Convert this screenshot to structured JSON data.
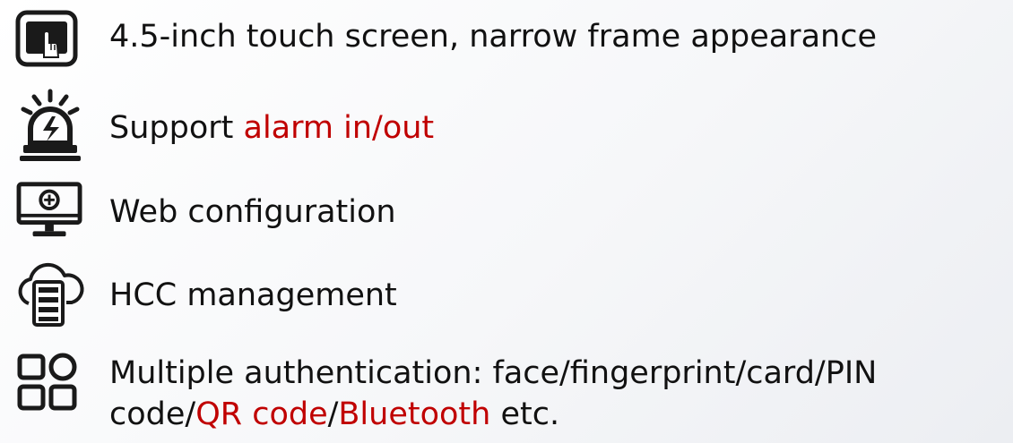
{
  "features": [
    {
      "icon": "touch-screen-icon",
      "text": "4.5-inch touch screen, narrow frame appearance"
    },
    {
      "icon": "alarm-siren-icon",
      "text_before": "Support ",
      "highlight": "alarm in/out"
    },
    {
      "icon": "monitor-config-icon",
      "text": "Web configuration"
    },
    {
      "icon": "cloud-server-icon",
      "text": "HCC management"
    },
    {
      "icon": "grid-squares-icon",
      "line1": "Multiple authentication: face/fingerprint/card/PIN",
      "line2_part1": "code/",
      "line2_highlight1": "QR code",
      "line2_sep": "/",
      "line2_highlight2": "Bluetooth",
      "line2_part2": " etc."
    }
  ],
  "colors": {
    "text": "#111111",
    "highlight": "#c00000",
    "icon": "#1a1a1a"
  }
}
